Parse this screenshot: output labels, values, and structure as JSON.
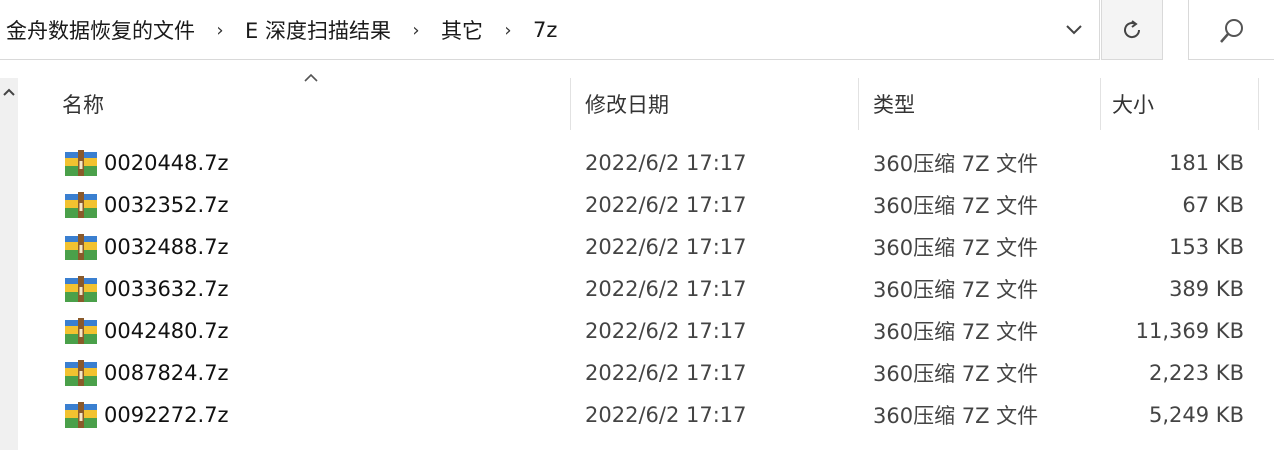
{
  "address_bar": {
    "crumbs": [
      "金舟数据恢复的文件",
      "E 深度扫描结果",
      "其它",
      "7z"
    ],
    "separator": "›",
    "dropdown_icon": "chevron-down-icon",
    "refresh_icon": "refresh-icon",
    "search_icon": "search-icon"
  },
  "columns": {
    "name": "名称",
    "date": "修改日期",
    "type": "类型",
    "size": "大小",
    "sort_indicator": "^"
  },
  "files": [
    {
      "name": "0020448.7z",
      "date": "2022/6/2 17:17",
      "type": "360压缩 7Z 文件",
      "size": "181 KB"
    },
    {
      "name": "0032352.7z",
      "date": "2022/6/2 17:17",
      "type": "360压缩 7Z 文件",
      "size": "67 KB"
    },
    {
      "name": "0032488.7z",
      "date": "2022/6/2 17:17",
      "type": "360压缩 7Z 文件",
      "size": "153 KB"
    },
    {
      "name": "0033632.7z",
      "date": "2022/6/2 17:17",
      "type": "360压缩 7Z 文件",
      "size": "389 KB"
    },
    {
      "name": "0042480.7z",
      "date": "2022/6/2 17:17",
      "type": "360压缩 7Z 文件",
      "size": "11,369 KB"
    },
    {
      "name": "0087824.7z",
      "date": "2022/6/2 17:17",
      "type": "360压缩 7Z 文件",
      "size": "2,223 KB"
    },
    {
      "name": "0092272.7z",
      "date": "2022/6/2 17:17",
      "type": "360压缩 7Z 文件",
      "size": "5,249 KB"
    }
  ],
  "file_icon": "archive-icon",
  "colors": {
    "icon_blue": "#3a7fd0",
    "icon_yellow": "#f2c230",
    "icon_green": "#4aa04a",
    "icon_brown": "#8a5a2b"
  }
}
